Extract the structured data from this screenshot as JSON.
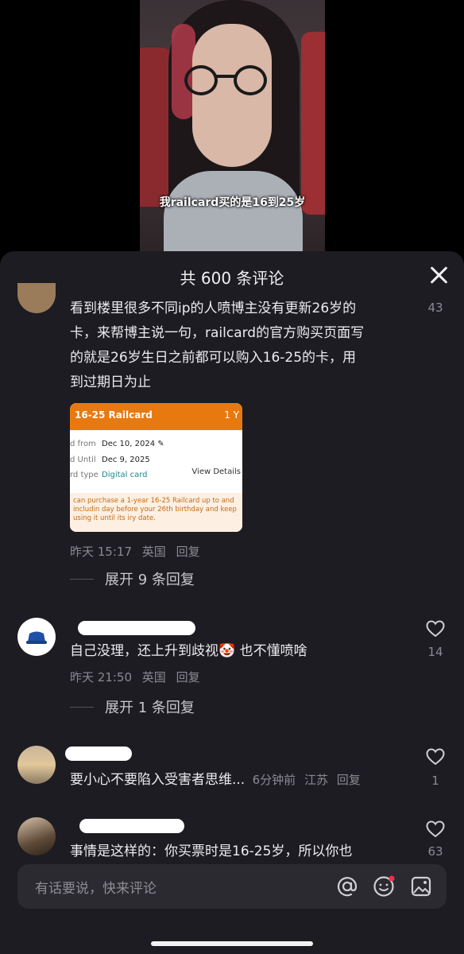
{
  "video": {
    "caption": "我railcard买的是16到25岁"
  },
  "sheet": {
    "title": "共 600 条评论"
  },
  "comments": [
    {
      "text": "看到楼里很多不同ip的人喷博主没有更新26岁的卡，来帮博主说一句，railcard的官方购买页面写的就是26岁生日之前都可以购入16-25的卡，用到过期日为止",
      "lines": [
        "看到楼里很多不同ip的人喷博主没有更新26岁的",
        "卡，来帮博主说一句，railcard的官方购买页面写",
        "的就是26岁生日之前都可以购入16-25的卡，用",
        "到过期日为止"
      ],
      "time": "昨天 15:17",
      "location": "英国",
      "reply": "回复",
      "likes": "43",
      "expand": "展开 9 条回复",
      "image": {
        "title": "16-25 Railcard",
        "year_tag": "1 Y",
        "rows": [
          {
            "key": "d from",
            "value": "Dec 10, 2024 ✎"
          },
          {
            "key": "d Until",
            "value": "Dec 9, 2025"
          },
          {
            "key": "rd type",
            "value": "Digital card"
          }
        ],
        "details_link": "View Details",
        "note": "can purchase a 1-year 16-25 Railcard up to and includin day before your 26th birthday and keep using it until its iry date."
      }
    },
    {
      "text": "自己没理，还上升到歧视🤡 也不懂喷啥",
      "time": "昨天 21:50",
      "location": "英国",
      "reply": "回复",
      "likes": "14",
      "expand": "展开 1 条回复"
    },
    {
      "text": "要小心不要陷入受害者思维...",
      "time": "6分钟前",
      "location": "江苏",
      "reply": "回复",
      "likes": "1"
    },
    {
      "text": "事情是这样的：你买票时是16-25岁，所以你也",
      "likes": "63"
    }
  ],
  "input": {
    "placeholder": "有话要说，快来评论"
  },
  "icons": [
    "close-icon",
    "heart-icon",
    "at-icon",
    "emoji-icon",
    "image-icon"
  ],
  "colors": {
    "sheet_bg": "#1d1c22",
    "accent_orange": "#e8790f",
    "notification_dot": "#ff2b4a"
  }
}
